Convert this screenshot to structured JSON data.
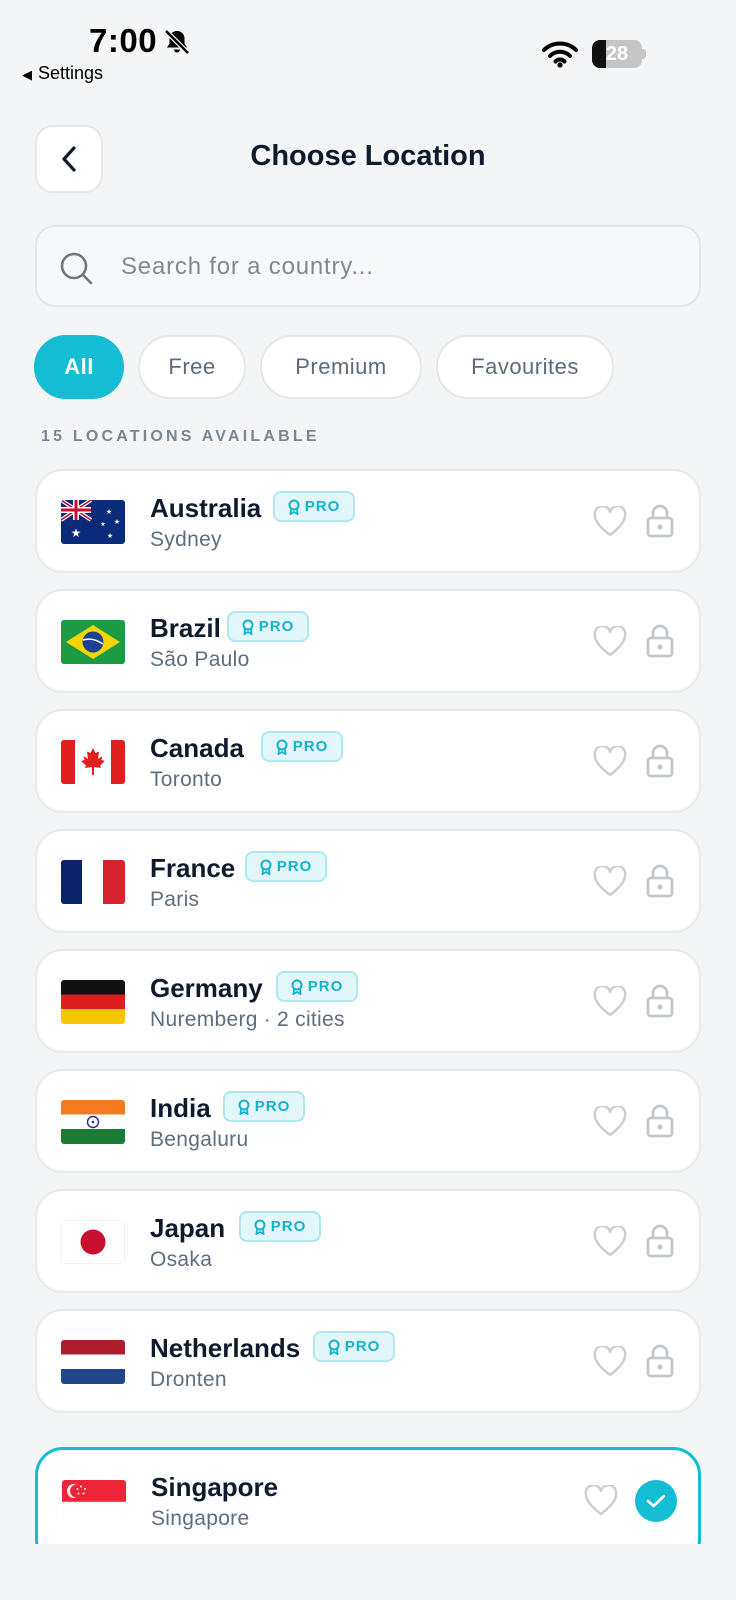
{
  "status_bar": {
    "time": "7:00",
    "back_app_label": "Settings",
    "battery_percent": "28",
    "battery_level": 0.28
  },
  "header": {
    "title": "Choose Location"
  },
  "search": {
    "placeholder": "Search for a country..."
  },
  "filters": {
    "items": [
      {
        "label": "All",
        "active": true
      },
      {
        "label": "Free",
        "active": false
      },
      {
        "label": "Premium",
        "active": false
      },
      {
        "label": "Favourites",
        "active": false
      }
    ]
  },
  "count_label": "15 LOCATIONS AVAILABLE",
  "badge_label": "PRO",
  "colors": {
    "accent": "#14bcd4",
    "title": "#0f1b2d",
    "subtext": "#5e6e80",
    "background": "#f3f5f6"
  },
  "locations": [
    {
      "country": "Australia",
      "city": "Sydney",
      "extra": "",
      "pro": true,
      "selected": false,
      "flag": "australia-flag-icon"
    },
    {
      "country": "Brazil",
      "city": "São Paulo",
      "extra": "",
      "pro": true,
      "selected": false,
      "flag": "brazil-flag-icon"
    },
    {
      "country": "Canada",
      "city": "Toronto",
      "extra": "",
      "pro": true,
      "selected": false,
      "flag": "canada-flag-icon"
    },
    {
      "country": "France",
      "city": "Paris",
      "extra": "",
      "pro": true,
      "selected": false,
      "flag": "france-flag-icon"
    },
    {
      "country": "Germany",
      "city": "Nuremberg",
      "extra": "2 cities",
      "pro": true,
      "selected": false,
      "flag": "germany-flag-icon"
    },
    {
      "country": "India",
      "city": "Bengaluru",
      "extra": "",
      "pro": true,
      "selected": false,
      "flag": "india-flag-icon"
    },
    {
      "country": "Japan",
      "city": "Osaka",
      "extra": "",
      "pro": true,
      "selected": false,
      "flag": "japan-flag-icon"
    },
    {
      "country": "Netherlands",
      "city": "Dronten",
      "extra": "",
      "pro": true,
      "selected": false,
      "flag": "netherlands-flag-icon"
    },
    {
      "country": "Singapore",
      "city": "Singapore",
      "extra": "",
      "pro": false,
      "selected": true,
      "flag": "singapore-flag-icon"
    }
  ]
}
